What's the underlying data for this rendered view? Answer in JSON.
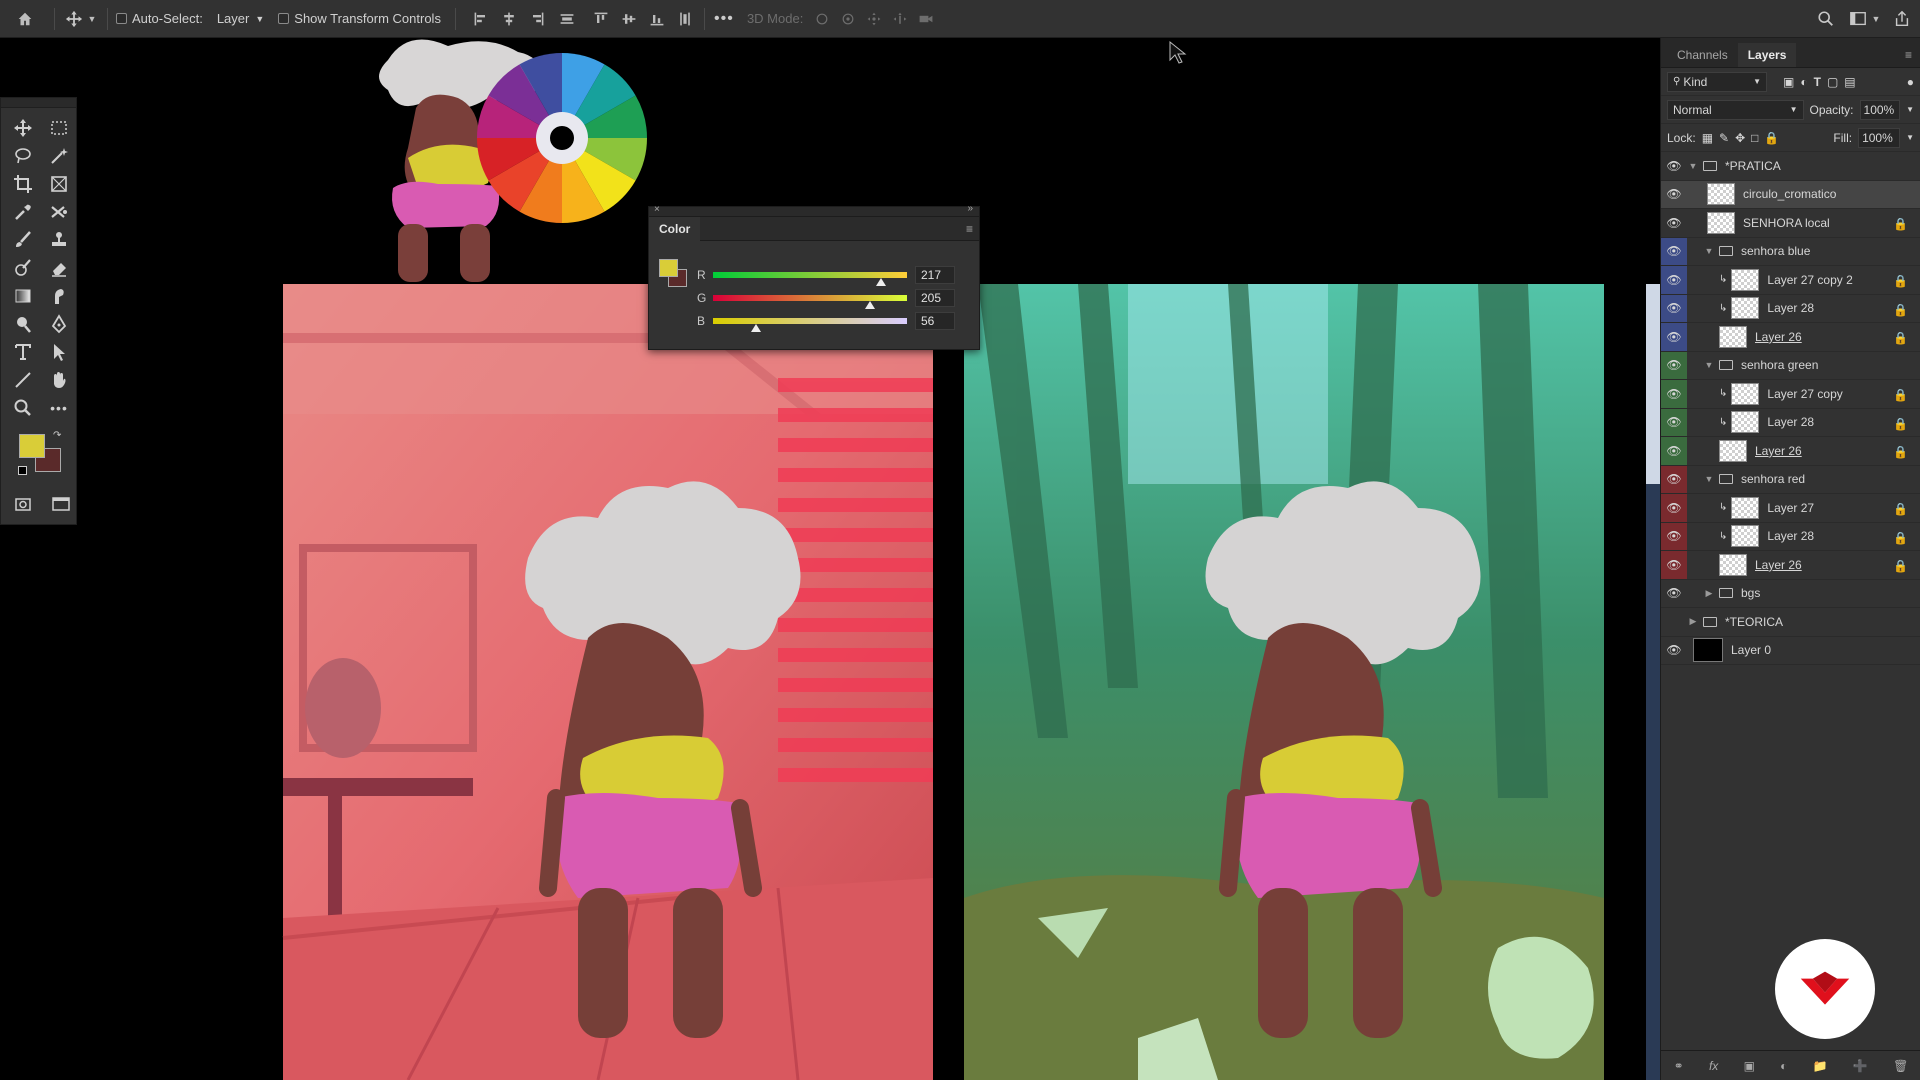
{
  "optionsbar": {
    "auto_select_label": "Auto-Select:",
    "auto_select_value": "Layer",
    "show_transform_label": "Show Transform Controls",
    "mode3d_label": "3D Mode:"
  },
  "toolbar": {
    "foreground_color": "#D9CD38",
    "background_color": "#5A2A2A"
  },
  "color_panel": {
    "tab": "Color",
    "r_label": "R",
    "r_value": "217",
    "g_label": "G",
    "g_value": "205",
    "b_label": "B",
    "b_value": "56",
    "swatch": "#D9CD38"
  },
  "layers_panel": {
    "tabs": [
      "Channels",
      "Layers"
    ],
    "active_tab": "Layers",
    "filter_label": "Kind",
    "blend_mode": "Normal",
    "opacity_label": "Opacity:",
    "opacity_value": "100%",
    "lock_label": "Lock:",
    "fill_label": "Fill:",
    "fill_value": "100%",
    "layers": [
      {
        "name": "*PRATICA"
      },
      {
        "name": "circulo_cromatico"
      },
      {
        "name": "SENHORA local"
      },
      {
        "name": "senhora blue"
      },
      {
        "name": "Layer 27 copy 2"
      },
      {
        "name": "Layer 28"
      },
      {
        "name": "Layer 26"
      },
      {
        "name": "senhora green"
      },
      {
        "name": "Layer 27 copy"
      },
      {
        "name": "Layer 28"
      },
      {
        "name": "Layer 26"
      },
      {
        "name": "senhora red"
      },
      {
        "name": "Layer 27"
      },
      {
        "name": "Layer 28"
      },
      {
        "name": "Layer 26"
      },
      {
        "name": "bgs"
      },
      {
        "name": "*TEORICA"
      },
      {
        "name": "Layer 0"
      }
    ]
  }
}
